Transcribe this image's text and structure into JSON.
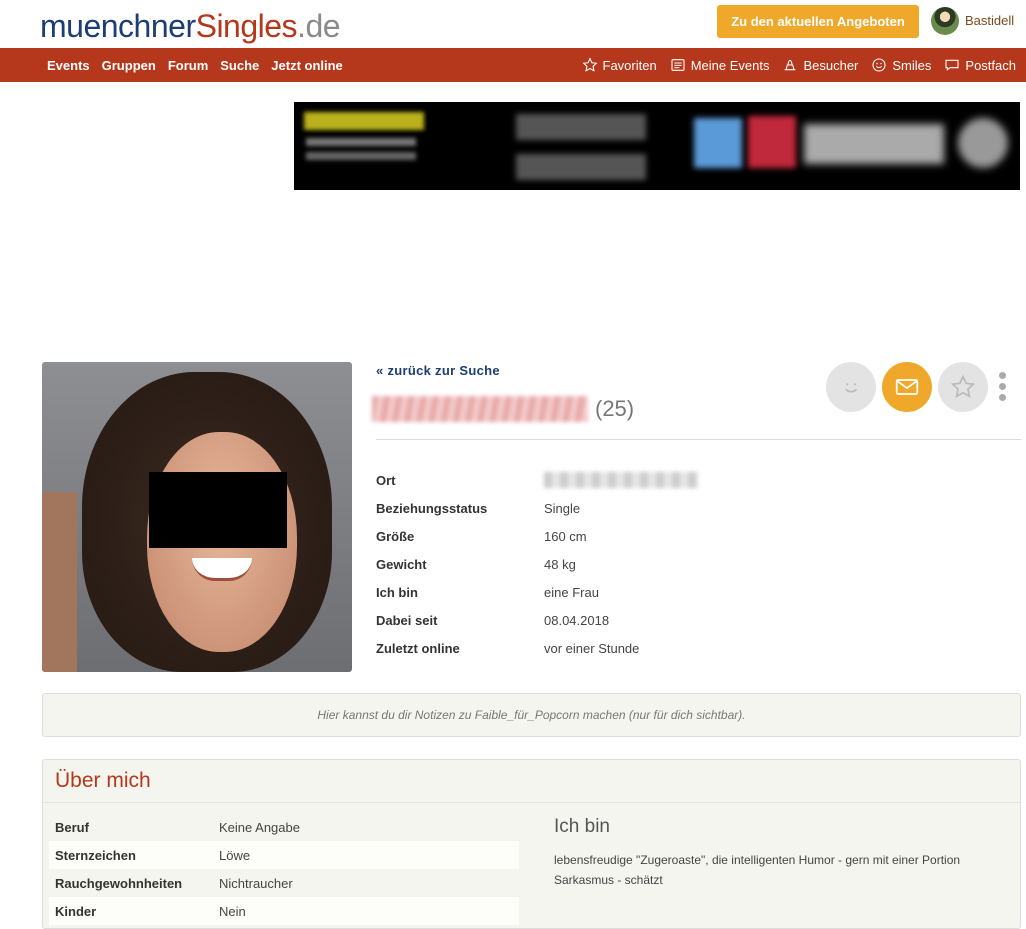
{
  "header": {
    "logo": {
      "part1": "muenchner",
      "part2": "Singles",
      "part3": ".de"
    },
    "offers_button": "Zu den aktuellen Angeboten",
    "user_name": "Bastidell"
  },
  "nav": {
    "left": [
      "Events",
      "Gruppen",
      "Forum",
      "Suche",
      "Jetzt online"
    ],
    "right": [
      {
        "label": "Favoriten",
        "icon": "star-icon"
      },
      {
        "label": "Meine Events",
        "icon": "list-icon"
      },
      {
        "label": "Besucher",
        "icon": "visitor-icon"
      },
      {
        "label": "Smiles",
        "icon": "smiley-icon"
      },
      {
        "label": "Postfach",
        "icon": "message-icon"
      }
    ]
  },
  "profile": {
    "back_link": "« zurück zur Suche",
    "age": "(25)",
    "facts": [
      {
        "label": "Ort",
        "value": ""
      },
      {
        "label": "Beziehungsstatus",
        "value": "Single"
      },
      {
        "label": "Größe",
        "value": "160 cm"
      },
      {
        "label": "Gewicht",
        "value": "48 kg"
      },
      {
        "label": "Ich bin",
        "value": "eine Frau"
      },
      {
        "label": "Dabei seit",
        "value": "08.04.2018"
      },
      {
        "label": "Zuletzt online",
        "value": "vor einer Stunde"
      }
    ]
  },
  "notes": {
    "text": "Hier kannst du dir Notizen zu Faible_für_Popcorn machen (nur für dich sichtbar)."
  },
  "about": {
    "title": "Über mich",
    "rows": [
      {
        "label": "Beruf",
        "value": "Keine Angabe"
      },
      {
        "label": "Sternzeichen",
        "value": "Löwe"
      },
      {
        "label": "Rauchgewohnheiten",
        "value": "Nichtraucher"
      },
      {
        "label": "Kinder",
        "value": "Nein"
      }
    ],
    "ich_bin_heading": "Ich bin",
    "ich_bin_text": "lebensfreudige \"Zugeroaste\", die intelligenten Humor - gern mit einer Portion Sarkasmus - schätzt"
  },
  "colors": {
    "brand_red": "#b5381d",
    "brand_blue": "#1d3d76",
    "accent_orange": "#f0a82a"
  }
}
